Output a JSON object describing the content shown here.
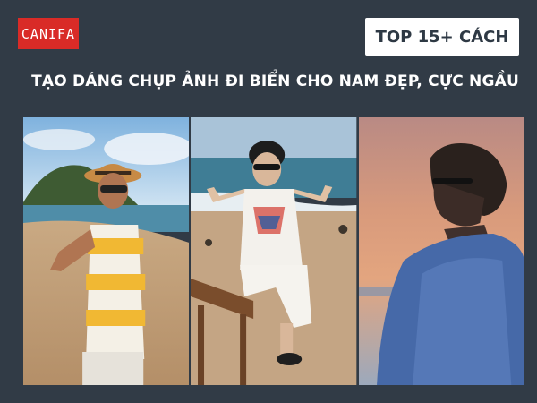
{
  "brand": {
    "logo_text": "CANIFA",
    "logo_color": "#d92b27"
  },
  "badge": {
    "text": "TOP 15+ CÁCH"
  },
  "headline": {
    "text": "TẠO DÁNG CHỤP ẢNH ĐI BIỂN CHO NAM ĐẸP, CỰC NGẦU"
  },
  "colors": {
    "background": "#313b46",
    "badge_text": "#2e3944"
  },
  "photos": [
    {
      "name": "beach-photo-hat-pointing"
    },
    {
      "name": "beach-photo-seated-peace-sign"
    },
    {
      "name": "beach-photo-sunset-profile"
    }
  ]
}
